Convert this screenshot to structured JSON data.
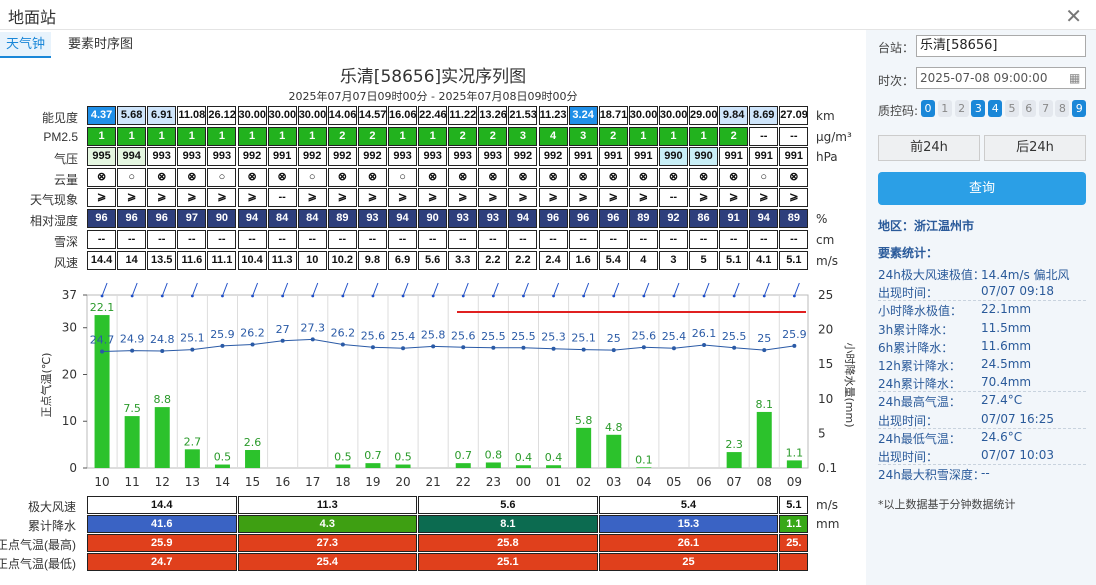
{
  "window": {
    "title": "地面站"
  },
  "tabs": [
    {
      "label": "天气钟"
    },
    {
      "label": "要素时序图"
    }
  ],
  "chart": {
    "title": "乐清[58656]实况序列图",
    "subtitle": "2025年07月07日09时00分 - 2025年07月08日09时00分"
  },
  "colors": {
    "accent": "#1a87d8"
  },
  "hours": [
    "10",
    "11",
    "12",
    "13",
    "14",
    "15",
    "16",
    "17",
    "18",
    "19",
    "20",
    "21",
    "22",
    "23",
    "00",
    "01",
    "02",
    "03",
    "04",
    "05",
    "06",
    "07",
    "08",
    "09"
  ],
  "visibility": {
    "label": "能见度",
    "unit": "km",
    "values": [
      "4.37",
      "5.68",
      "6.91",
      "11.08",
      "26.12",
      "30.00",
      "30.00",
      "30.00",
      "14.06",
      "14.57",
      "16.06",
      "22.46",
      "11.22",
      "13.26",
      "21.53",
      "11.23",
      "3.24",
      "18.71",
      "30.00",
      "30.00",
      "29.00",
      "9.84",
      "8.69",
      "27.09"
    ]
  },
  "pm25": {
    "label": "PM2.5",
    "unit": "μg/m³",
    "values": [
      "1",
      "1",
      "1",
      "1",
      "1",
      "1",
      "1",
      "1",
      "2",
      "2",
      "1",
      "1",
      "2",
      "2",
      "3",
      "4",
      "3",
      "2",
      "1",
      "1",
      "1",
      "2",
      "--",
      "--"
    ]
  },
  "pressure": {
    "label": "气压",
    "unit": "hPa",
    "values": [
      "995",
      "994",
      "993",
      "993",
      "993",
      "992",
      "991",
      "992",
      "992",
      "992",
      "993",
      "993",
      "993",
      "993",
      "992",
      "992",
      "991",
      "991",
      "991",
      "990",
      "990",
      "991",
      "991",
      "991"
    ]
  },
  "cloud": {
    "label": "云量",
    "symbols": [
      "⊗",
      "○",
      "⊗",
      "⊗",
      "○",
      "⊗",
      "⊗",
      "○",
      "⊗",
      "⊗",
      "○",
      "⊗",
      "⊗",
      "⊗",
      "⊗",
      "⊗",
      "⊗",
      "⊗",
      "⊗",
      "⊗",
      "⊗",
      "⊗",
      "○",
      "⊗"
    ]
  },
  "weather": {
    "label": "天气现象",
    "symbols": [
      "⩾",
      "⩾",
      "⩾",
      "⩾",
      "⩾",
      "⩾",
      "--",
      "⩾",
      "⩾",
      "⩾",
      "⩾",
      "⩾",
      "⩾",
      "⩾",
      "⩾",
      "⩾",
      "⩾",
      "⩾",
      "⩾",
      "--",
      "⩾",
      "⩾",
      "⩾",
      "⩾"
    ]
  },
  "humidity": {
    "label": "相对湿度",
    "unit": "%",
    "values": [
      "96",
      "96",
      "96",
      "97",
      "90",
      "94",
      "84",
      "84",
      "89",
      "93",
      "94",
      "90",
      "93",
      "93",
      "94",
      "96",
      "96",
      "96",
      "89",
      "92",
      "86",
      "91",
      "94",
      "89"
    ]
  },
  "snow": {
    "label": "雪深",
    "unit": "cm",
    "values": [
      "--",
      "--",
      "--",
      "--",
      "--",
      "--",
      "--",
      "--",
      "--",
      "--",
      "--",
      "--",
      "--",
      "--",
      "--",
      "--",
      "--",
      "--",
      "--",
      "--",
      "--",
      "--",
      "--",
      "--"
    ]
  },
  "wind": {
    "label": "风速",
    "unit": "m/s",
    "values": [
      "14.4",
      "14",
      "13.5",
      "11.6",
      "11.1",
      "10.4",
      "11.3",
      "10",
      "10.2",
      "9.8",
      "6.9",
      "5.6",
      "3.3",
      "2.2",
      "2.2",
      "2.4",
      "1.6",
      "5.4",
      "4",
      "3",
      "5",
      "5.1",
      "4.1",
      "5.1"
    ]
  },
  "chart_data": {
    "type": "bar",
    "x": [
      "10",
      "11",
      "12",
      "13",
      "14",
      "15",
      "16",
      "17",
      "18",
      "19",
      "20",
      "21",
      "22",
      "23",
      "00",
      "01",
      "02",
      "03",
      "04",
      "05",
      "06",
      "07",
      "08",
      "09"
    ],
    "series": [
      {
        "name": "正点气温",
        "values": [
          24.7,
          24.9,
          24.8,
          25.1,
          25.9,
          26.2,
          27,
          27.3,
          26.2,
          25.6,
          25.4,
          25.8,
          25.6,
          25.5,
          25.5,
          25.3,
          25.1,
          25,
          25.6,
          25.4,
          26.1,
          25.5,
          25,
          25.9
        ]
      },
      {
        "name": "小时降水量",
        "values": [
          22.1,
          7.5,
          8.8,
          2.7,
          0.5,
          2.6,
          0,
          0,
          0.5,
          0.7,
          0.5,
          0,
          0.7,
          0.8,
          0.4,
          0.4,
          5.8,
          4.8,
          0.1,
          0,
          0,
          2.3,
          8.1,
          1.1
        ],
        "labels": [
          "22.1",
          "7.5",
          "8.8",
          "2.7",
          "0.5",
          "2.6",
          "",
          "",
          "0.5",
          "0.7",
          "0.5",
          "",
          "0.7",
          "0.8",
          "0.4",
          "0.4",
          "5.8",
          "4.8",
          "0.1",
          "",
          "",
          "2.3",
          "8.1",
          "1.1"
        ]
      }
    ],
    "ylabel_left": "正点气温(℃)",
    "ylabel_right": "小时降水量(mm)",
    "yticks_left": [
      "37",
      "30",
      "20",
      "10",
      "0"
    ],
    "yticks_right": [
      "25",
      "20",
      "15",
      "10",
      "5",
      "0.1"
    ]
  },
  "summary": {
    "wind": {
      "label": "极大风速",
      "unit": "m/s",
      "values": [
        "14.4",
        "11.3",
        "5.6",
        "5.4",
        "5.1"
      ]
    },
    "rain": {
      "label": "累计降水",
      "unit": "mm",
      "values": [
        "41.6",
        "4.3",
        "8.1",
        "15.3",
        "1.1"
      ]
    },
    "tmax": {
      "label": "正点气温(最高)",
      "values": [
        "25.9",
        "27.3",
        "25.8",
        "26.1",
        "25."
      ]
    },
    "tmin": {
      "label": "正点气温(最低)",
      "values": [
        "24.7",
        "25.4",
        "25.1",
        "25",
        ""
      ]
    }
  },
  "sidebar": {
    "station_label": "台站：",
    "station_value": "乐清[58656]",
    "time_label": "时次：",
    "time_value": "2025-07-08 09:00:00",
    "qc_label": "质控码:",
    "qc": [
      "0",
      "1",
      "2",
      "3",
      "4",
      "5",
      "6",
      "7",
      "8",
      "9"
    ],
    "prev": "前24h",
    "next": "后24h",
    "query": "查询",
    "region": "地区：浙江温州市",
    "stats_title": "要素统计：",
    "stats": [
      {
        "k": "24h极大风速极值：",
        "v": "14.4m/s 偏北风"
      },
      {
        "k": "出现时间：",
        "v": "07/07 09:18"
      },
      {
        "k": "小时降水极值：",
        "v": "22.1mm"
      },
      {
        "k": "3h累计降水：",
        "v": "11.5mm"
      },
      {
        "k": "6h累计降水：",
        "v": "11.6mm"
      },
      {
        "k": "12h累计降水：",
        "v": "24.5mm"
      },
      {
        "k": "24h累计降水：",
        "v": "70.4mm"
      },
      {
        "k": "24h最高气温：",
        "v": "27.4°C"
      },
      {
        "k": "出现时间：",
        "v": "07/07 16:25"
      },
      {
        "k": "24h最低气温：",
        "v": "24.6°C"
      },
      {
        "k": "出现时间：",
        "v": "07/07 10:03"
      },
      {
        "k": "24h最大积雪深度：",
        "v": "--"
      }
    ],
    "note": "*以上数据基于分钟数据统计"
  }
}
